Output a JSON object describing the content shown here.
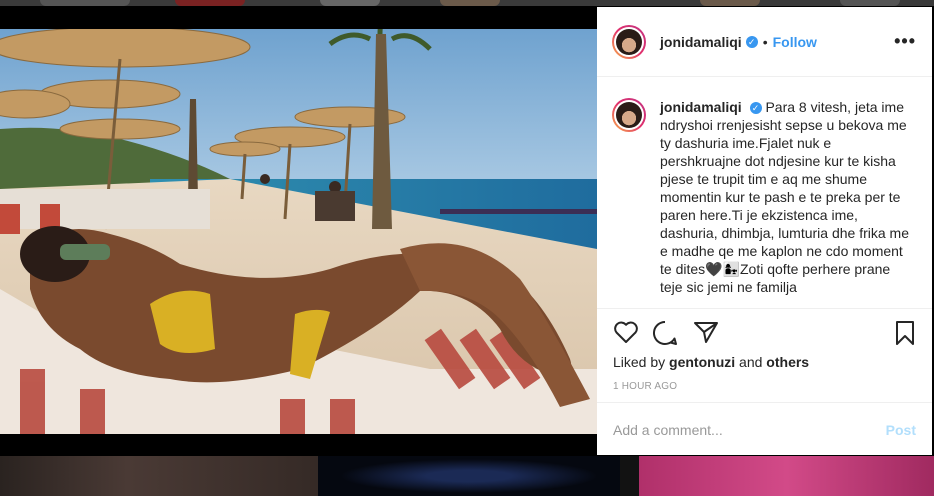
{
  "post": {
    "username": "jonidamaliqi",
    "verified_mark": "✓",
    "separator": "•",
    "follow_label": "Follow",
    "more_label": "•••",
    "caption": "Para 8 vitesh, jeta ime ndryshoi rrenjesisht sepse u bekova me ty dashuria ime.Fjalet nuk e pershkruajne dot ndjesine kur te kisha pjese te trupit tim e aq me shume momentin kur te pash e te preka per te paren here.Ti je ekzistenca ime, dashuria, dhimbja, lumturia dhe frika me e madhe qe me kaplon ne cdo moment te dites🖤👩‍👧Zoti qofte perhere prane teje sic jemi ne familja",
    "liked_by_prefix": "Liked by",
    "liked_by_user": "gentonuzi",
    "liked_by_and": "and",
    "liked_by_others": "others",
    "timestamp": "1 HOUR AGO",
    "comment_placeholder": "Add a comment...",
    "post_button": "Post"
  },
  "icons": {
    "like": "heart-icon",
    "comment": "comment-icon",
    "share": "share-icon",
    "save": "bookmark-icon",
    "more": "more-options-icon"
  },
  "colors": {
    "link_blue": "#3897f0",
    "post_disabled": "#b2dffc",
    "text": "#262626",
    "muted": "#999999"
  }
}
